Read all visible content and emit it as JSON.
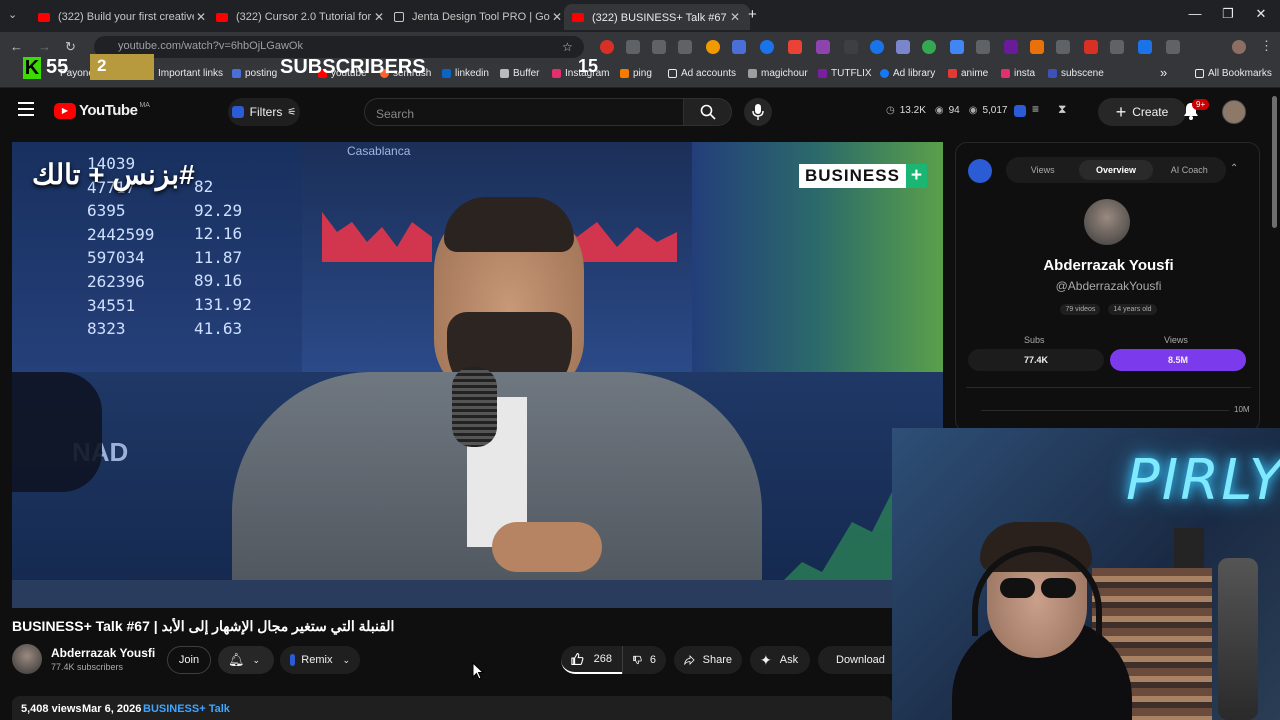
{
  "browser": {
    "tabs": [
      {
        "title": "(322) Build your first creative A",
        "icon": "youtube-icon"
      },
      {
        "title": "(322) Cursor 2.0 Tutorial for Be",
        "icon": "youtube-icon"
      },
      {
        "title": "Jenta Design Tool PRO | Googl",
        "icon": "page-icon"
      },
      {
        "title": "(322) BUSINESS+ Talk #67 | الأبد",
        "icon": "youtube-icon"
      }
    ],
    "url": "youtube.com/watch?v=6hbOjLGawOk",
    "bookmarks": [
      "Payone",
      "Important links",
      "posting",
      "youtube",
      "semrush",
      "linkedin",
      "Buffer",
      "Instagram",
      "ping",
      "Ad accounts",
      "magichour",
      "TUTFLIX",
      "Ad library",
      "anime",
      "insta",
      "subscene",
      "All Bookmarks"
    ],
    "bookmark_overflow": "»"
  },
  "counter": {
    "left_value": "55",
    "rank": "2",
    "label": "SUBSCRIBERS",
    "right_value": "15"
  },
  "youtube": {
    "logo_text": "YouTube",
    "logo_region": "MA",
    "filters_label": "Filters",
    "search_placeholder": "Search",
    "stats": {
      "stat1": "13.2K",
      "stat2": "94",
      "stat3": "5,017"
    },
    "create_label": "Create",
    "notification_badge": "9+"
  },
  "video": {
    "overlay_hashtag": "#بزنس + تالك",
    "brand_badge": "BUSINESS",
    "brand_plus": "+",
    "board_numbers": [
      "14039",
      "47717",
      "6395",
      "2442599",
      "597034",
      "262396",
      "34551",
      "8323"
    ],
    "board_numbers_right": [
      "82",
      "92.29",
      "12.16",
      "11.87",
      "89.16",
      "131.92",
      "41.63"
    ],
    "board_text_top": "Casablanca",
    "board_text_side": "NAD",
    "title": "BUSINESS+ Talk #67 | القنبلة التي ستغير مجال الإشهار إلى الأبد",
    "channel_name": "Abderrazak Yousfi",
    "channel_subs": "77.4K subscribers",
    "join_label": "Join",
    "remix_label": "Remix",
    "likes": "268",
    "dislikes": "6",
    "share_label": "Share",
    "ask_label": "Ask",
    "download_label": "Download",
    "views": "5,408 views",
    "date": "Mar 6, 2026",
    "hashtag_link": "BUSINESS+ Talk"
  },
  "panel": {
    "tabs": [
      "Views",
      "Overview",
      "AI Coach"
    ],
    "active_tab": "Overview",
    "name": "Abderrazak Yousfi",
    "handle": "@AbderrazakYousfi",
    "videos": "79 videos",
    "age": "14 years old",
    "subs_label": "Subs",
    "subs_value": "77.4K",
    "views_label": "Views",
    "views_value": "8.5M",
    "chart_tick": "10M"
  },
  "webcam": {
    "neon_sign": "PIRLY"
  },
  "colors": {
    "accent_purple": "#7c3aed",
    "youtube_red": "#ff0000",
    "neon": "#7fe9ff"
  }
}
